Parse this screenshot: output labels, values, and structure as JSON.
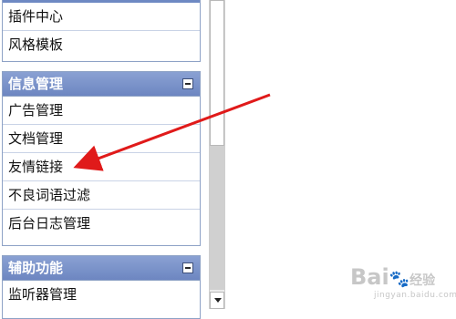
{
  "sidebar": {
    "panels": [
      {
        "items": [
          {
            "label": "插件中心"
          },
          {
            "label": "风格模板"
          }
        ]
      },
      {
        "title": "信息管理",
        "items": [
          {
            "label": "广告管理"
          },
          {
            "label": "文档管理"
          },
          {
            "label": "友情链接"
          },
          {
            "label": "不良词语过滤"
          },
          {
            "label": "后台日志管理"
          }
        ]
      },
      {
        "title": "辅助功能",
        "items": [
          {
            "label": "监听器管理"
          }
        ]
      }
    ]
  },
  "annotation": {
    "arrow_color": "#e01a1a",
    "target": "友情链接"
  },
  "watermark": {
    "logo_text": "Bai",
    "logo_suffix": "经验",
    "url": "jingyan.baidu.com"
  },
  "colors": {
    "panel_header": "#6d86c1",
    "panel_border": "#8ea2c6",
    "arrow": "#e01a1a"
  }
}
